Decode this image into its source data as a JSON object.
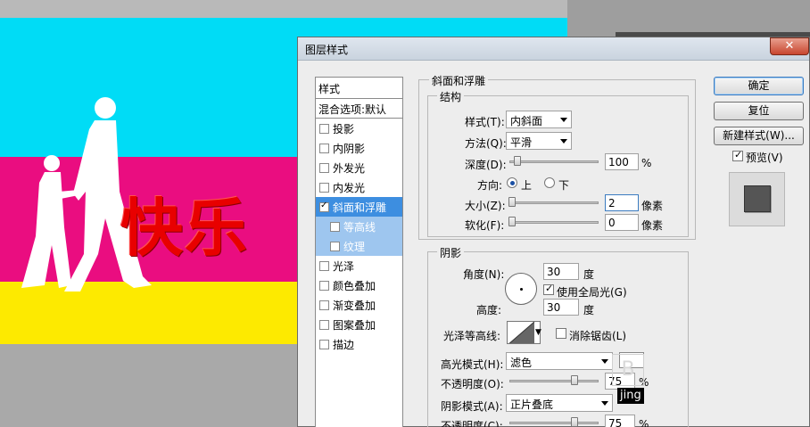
{
  "canvas": {
    "text": "快乐",
    "colors": {
      "cyan": "#00dcf6",
      "magenta": "#ea0d80",
      "yellow": "#fdea00",
      "text_red": "#e80000"
    }
  },
  "dialog": {
    "title": "图层样式",
    "close_label": "✕",
    "style_list": {
      "header": "样式",
      "blend": "混合选项:默认",
      "items": [
        {
          "label": "投影",
          "checked": false
        },
        {
          "label": "内阴影",
          "checked": false
        },
        {
          "label": "外发光",
          "checked": false
        },
        {
          "label": "内发光",
          "checked": false
        },
        {
          "label": "斜面和浮雕",
          "checked": true
        },
        {
          "label": "等高线",
          "checked": false
        },
        {
          "label": "纹理",
          "checked": false
        },
        {
          "label": "光泽",
          "checked": false
        },
        {
          "label": "颜色叠加",
          "checked": false
        },
        {
          "label": "渐变叠加",
          "checked": false
        },
        {
          "label": "图案叠加",
          "checked": false
        },
        {
          "label": "描边",
          "checked": false
        }
      ]
    },
    "bevel": {
      "section_title": "斜面和浮雕",
      "structure_title": "结构",
      "style_label": "样式(T):",
      "style_value": "内斜面",
      "method_label": "方法(Q):",
      "method_value": "平滑",
      "depth_label": "深度(D):",
      "depth_value": "100",
      "depth_unit": "%",
      "direction_label": "方向:",
      "dir_up": "上",
      "dir_down": "下",
      "size_label": "大小(Z):",
      "size_value": "2",
      "size_unit": "像素",
      "soften_label": "软化(F):",
      "soften_value": "0",
      "soften_unit": "像素"
    },
    "shading": {
      "title": "阴影",
      "angle_label": "角度(N):",
      "angle_value": "30",
      "angle_unit": "度",
      "global_light_label": "使用全局光(G)",
      "altitude_label": "高度:",
      "altitude_value": "30",
      "altitude_unit": "度",
      "gloss_label": "光泽等高线:",
      "antialias_label": "消除锯齿(L)",
      "highlight_mode_label": "高光模式(H):",
      "highlight_mode_value": "滤色",
      "highlight_opacity_label": "不透明度(O):",
      "highlight_opacity_value": "75",
      "shadow_mode_label": "阴影模式(A):",
      "shadow_mode_value": "正片叠底",
      "shadow_opacity_label": "不透明度(C):",
      "shadow_opacity_value": "75",
      "percent": "%"
    },
    "buttons": {
      "ok": "确定",
      "reset": "复位",
      "new_style": "新建样式(W)...",
      "preview": "预览(V)"
    },
    "watermark": {
      "glyph": "B",
      "tag": "jing"
    }
  }
}
